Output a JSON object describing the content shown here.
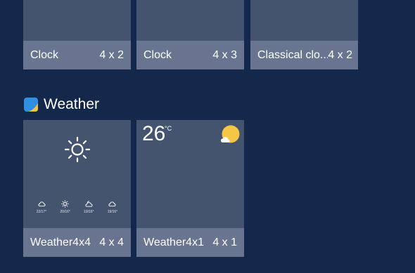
{
  "clock_widgets": [
    {
      "name": "Clock",
      "size": "4 x 2"
    },
    {
      "name": "Clock",
      "size": "4 x 3"
    },
    {
      "name": "Classical clo...",
      "size": "4 x 2"
    }
  ],
  "weather_section": {
    "title": "Weather",
    "widgets": [
      {
        "name": "Weather4x4",
        "size": "4 x 4"
      },
      {
        "name": "Weather4x1",
        "size": "4 x 1"
      }
    ],
    "forecast": [
      {
        "icon": "cloud-icon",
        "temp": "22/17°"
      },
      {
        "icon": "sun-icon",
        "temp": "20/16°"
      },
      {
        "icon": "partly-cloudy-icon",
        "temp": "19/16°"
      },
      {
        "icon": "cloud-icon",
        "temp": "19/16°"
      }
    ],
    "current_temp": "26",
    "current_unit": "°C"
  },
  "colors": {
    "background": "#14284c",
    "card": "#44536e",
    "label_bar": "#687490",
    "sun": "#f6c744",
    "section_icon_blue": "#2f8fe0",
    "section_icon_yellow": "#f3c43d"
  }
}
